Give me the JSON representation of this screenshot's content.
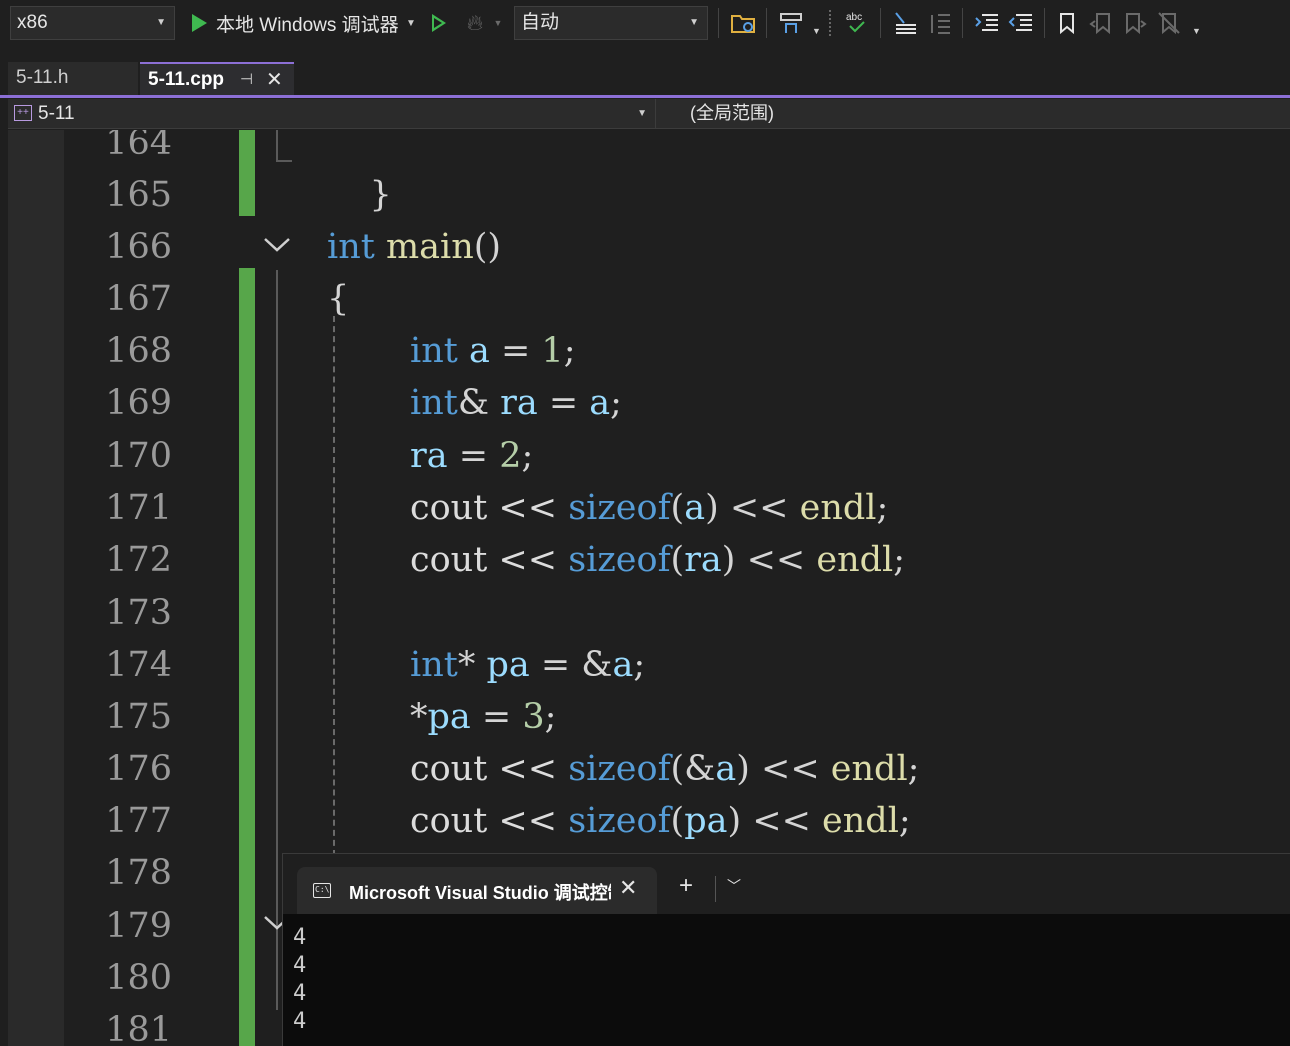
{
  "toolbar": {
    "platform": "x86",
    "debugger_label": "本地 Windows 调试器",
    "config": "自动",
    "icons": [
      "start-debug-icon",
      "start-without-debug-icon",
      "hot-reload-icon",
      "open-folder-icon",
      "toolbox-icon",
      "spell-check-icon",
      "format-icon",
      "comment-icon",
      "indent-icon",
      "outdent-icon",
      "bookmark-icon",
      "prev-bookmark-icon",
      "next-bookmark-icon",
      "clear-bookmark-icon"
    ]
  },
  "tabs": [
    {
      "label": "5-11.h",
      "active": false
    },
    {
      "label": "5-11.cpp",
      "active": true
    }
  ],
  "navbar": {
    "project": "5-11",
    "scope": "(全局范围)"
  },
  "editor": {
    "line_numbers": [
      "164",
      "165",
      "166",
      "167",
      "168",
      "169",
      "170",
      "171",
      "172",
      "173",
      "174",
      "175",
      "176",
      "177",
      "178",
      "179",
      "180",
      "181"
    ],
    "code": {
      "l164": "}",
      "l166_kw": "int",
      "l166_fn": "main",
      "l166_paren": "()",
      "l167": "{",
      "l168_kw": "int",
      "l168_var": "a",
      "l168_op": " = ",
      "l168_num": "1",
      "l168_end": ";",
      "l169_kw": "int",
      "l169_amp": "& ",
      "l169_var": "ra",
      "l169_op": " = ",
      "l169_var2": "a",
      "l169_end": ";",
      "l170_var": "ra",
      "l170_op": " = ",
      "l170_num": "2",
      "l170_end": ";",
      "l171_plain": "cout << ",
      "l171_kw": "sizeof",
      "l171_open": "(",
      "l171_var": "a",
      "l171_close": ") << ",
      "l171_fn": "endl",
      "l171_end": ";",
      "l172_plain": "cout << ",
      "l172_kw": "sizeof",
      "l172_open": "(",
      "l172_var": "ra",
      "l172_close": ") << ",
      "l172_fn": "endl",
      "l172_end": ";",
      "l174_kw": "int",
      "l174_star": "* ",
      "l174_var": "pa",
      "l174_op": " = &",
      "l174_var2": "a",
      "l174_end": ";",
      "l175_star": "*",
      "l175_var": "pa",
      "l175_op": " = ",
      "l175_num": "3",
      "l175_end": ";",
      "l176_plain": "cout << ",
      "l176_kw": "sizeof",
      "l176_open": "(&",
      "l176_var": "a",
      "l176_close": ") << ",
      "l176_fn": "endl",
      "l176_end": ";",
      "l177_plain": "cout << ",
      "l177_kw": "sizeof",
      "l177_open": "(",
      "l177_var": "pa",
      "l177_close": ") << ",
      "l177_fn": "endl",
      "l177_end": ";"
    }
  },
  "console": {
    "title": "Microsoft Visual Studio 调试控制台",
    "output": [
      "4",
      "4",
      "4",
      "4"
    ]
  }
}
